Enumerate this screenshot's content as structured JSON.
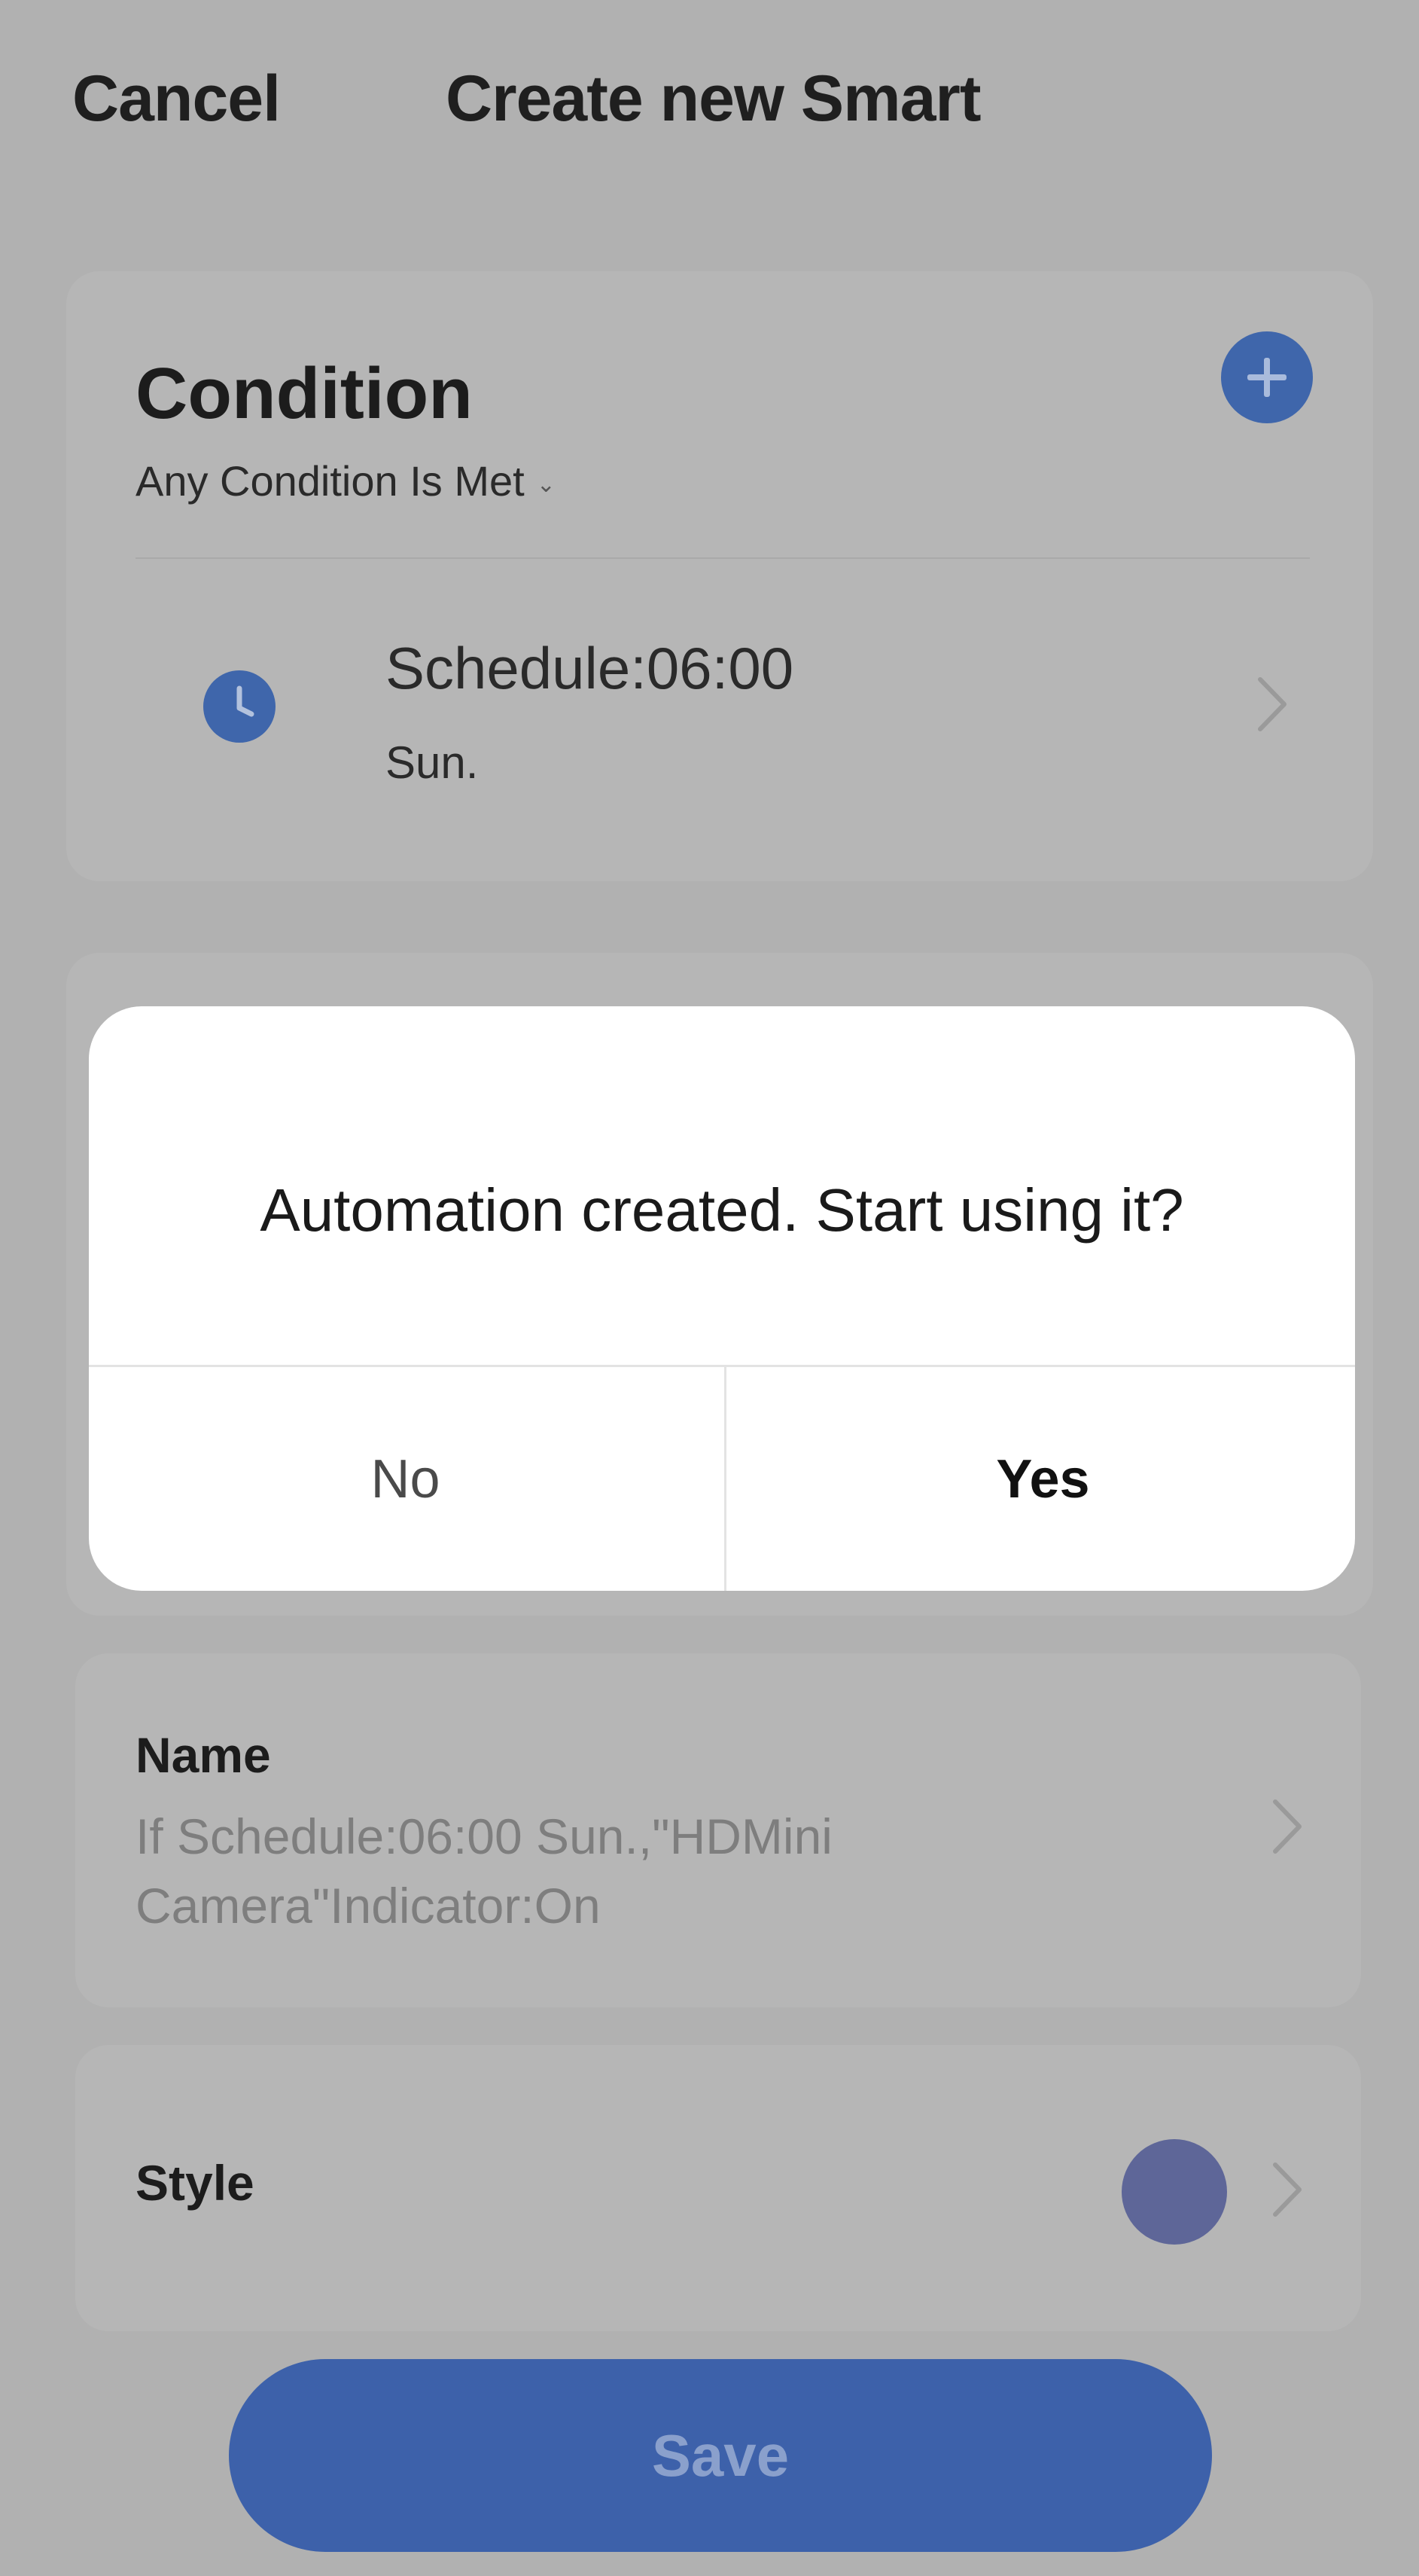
{
  "header": {
    "cancel_label": "Cancel",
    "title": "Create new Smart"
  },
  "condition": {
    "title": "Condition",
    "mode": "Any Condition Is Met",
    "add_icon": "plus-icon",
    "items": [
      {
        "icon": "clock-icon",
        "title": "Schedule:06:00",
        "subtitle": "Sun."
      }
    ]
  },
  "name": {
    "label": "Name",
    "value": "If Schedule:06:00 Sun.,\"HDMini Camera\"Indicator:On"
  },
  "style": {
    "label": "Style",
    "color": "#5e6698"
  },
  "save_label": "Save",
  "dialog": {
    "message": "Automation created. Start using it?",
    "no_label": "No",
    "yes_label": "Yes"
  },
  "colors": {
    "accent": "#3f66ab",
    "overlay": "#b1b1b1",
    "dialog_bg": "#ffffff"
  }
}
